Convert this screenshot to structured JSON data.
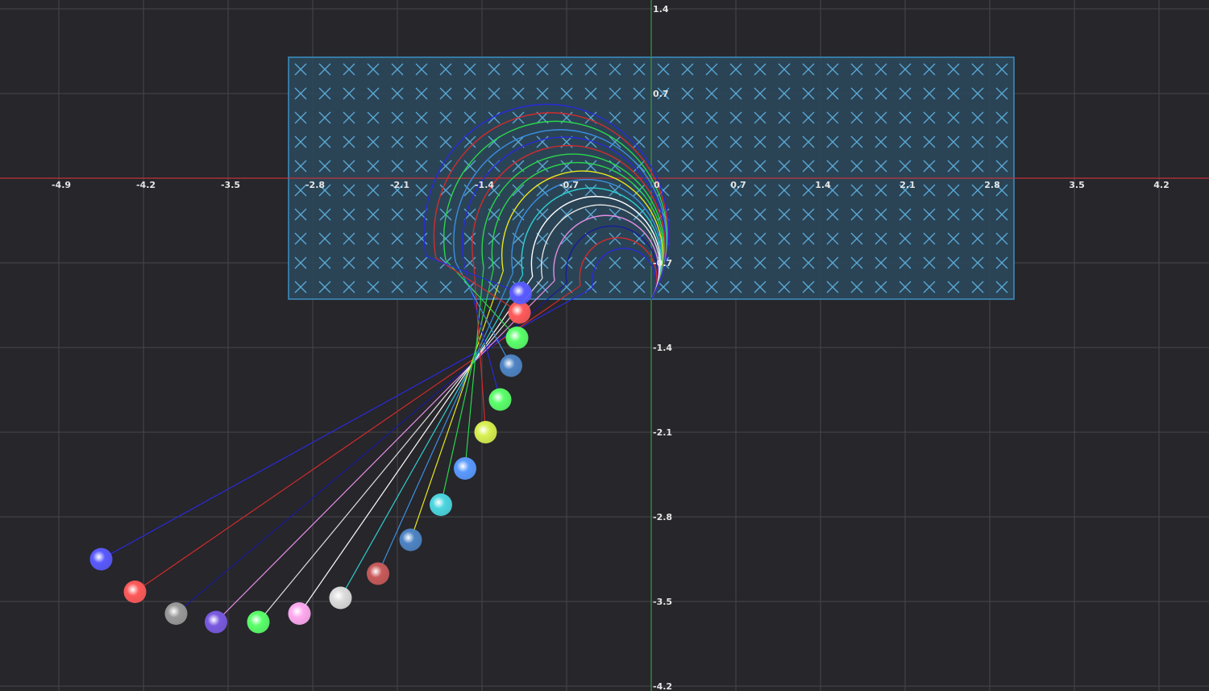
{
  "axes": {
    "x_ticks": [
      "-4.9",
      "-4.2",
      "-3.5",
      "-2.8",
      "-2.1",
      "-1.4",
      "-0.7",
      "0",
      "0.7",
      "1.4",
      "2.1",
      "2.8",
      "3.5",
      "4.2"
    ],
    "y_ticks": [
      "1.4",
      "0.7",
      "-0.7",
      "-1.4",
      "-2.1",
      "-2.8",
      "-3.5",
      "-4.2"
    ],
    "x_axis_color": "#c0343a",
    "y_axis_color": "#3a9a3a",
    "grid_color": "#45454b",
    "background": "#26262b"
  },
  "magnetic_field": {
    "region": {
      "x_min": -3.0,
      "x_max": 3.0,
      "y_min": -1.0,
      "y_max": 1.0
    },
    "direction": "into-page",
    "symbol": "×",
    "fill": "#2c4a5e",
    "border": "#3d8fc4",
    "cross_color": "#5aa9d6"
  },
  "entry_point": {
    "x": 0,
    "y": -1.0
  },
  "particles": [
    {
      "color": "#2a2ad9",
      "ball": "#5a5aff",
      "radius": 0.48,
      "hit": [
        -1.08,
        -0.95
      ],
      "end": [
        -4.55,
        -3.15
      ]
    },
    {
      "color": "#d22b2b",
      "ball": "#ff5a5a",
      "radius": 0.58,
      "hit": [
        -1.08,
        -1.1
      ],
      "end": [
        -4.27,
        -3.42
      ]
    },
    {
      "color": "#1b1b9a",
      "ball": "#9a9a9a",
      "radius": 0.69,
      "hit": [
        -1.15,
        -1.3
      ],
      "end": [
        -3.93,
        -3.6
      ]
    },
    {
      "color": "#e58ee5",
      "ball": "#7a5ae0",
      "radius": 0.79,
      "hit": [
        -1.2,
        -1.55
      ],
      "end": [
        -3.6,
        -3.67
      ]
    },
    {
      "color": "#e0e0e0",
      "ball": "#5aff6a",
      "radius": 0.89,
      "hit": [
        -1.28,
        -1.85
      ],
      "end": [
        -3.25,
        -3.67
      ]
    },
    {
      "color": "#ffffff",
      "ball": "#ffaaf0",
      "radius": 0.97,
      "hit": [
        -1.38,
        -2.14
      ],
      "end": [
        -2.91,
        -3.6
      ]
    },
    {
      "color": "#2fd0d0",
      "ball": "#dcdcdc",
      "radius": 1.05,
      "hit": [
        -1.55,
        -2.43
      ],
      "end": [
        -2.57,
        -3.47
      ]
    },
    {
      "color": "#3b8fe0",
      "ball": "#c85a5a",
      "radius": 1.13,
      "hit": [
        -1.75,
        -2.7
      ],
      "end": [
        -2.26,
        -3.27
      ]
    },
    {
      "color": "#e8e81c",
      "ball": "#4e84c4",
      "radius": 1.21,
      "hit": [
        -1.97,
        -2.98
      ],
      "end": [
        -1.99,
        -2.99
      ]
    },
    {
      "color": "#2ad64a",
      "ball": "#4cd6e0",
      "radius": 1.29,
      "hit": [
        -1.76,
        -2.7
      ],
      "end": [
        -1.74,
        -2.7
      ]
    },
    {
      "color": "#2ad64a",
      "ball": "#5a9aff",
      "radius": 1.37,
      "hit": [
        -1.55,
        -2.4
      ],
      "end": [
        -1.54,
        -2.4
      ]
    },
    {
      "color": "#d22b2b",
      "ball": "#d8f050",
      "radius": 1.45,
      "hit": [
        -1.38,
        -2.1
      ],
      "end": [
        -1.37,
        -2.1
      ]
    },
    {
      "color": "#2a2ad9",
      "ball": "#5aff6a",
      "radius": 1.53,
      "hit": [
        -1.25,
        -1.83
      ],
      "end": [
        -1.25,
        -1.83
      ]
    },
    {
      "color": "#3b8fe0",
      "ball": "#4e84c4",
      "radius": 1.6,
      "hit": [
        -1.16,
        -1.55
      ],
      "end": [
        -1.16,
        -1.55
      ]
    },
    {
      "color": "#2ad64a",
      "ball": "#5aff6a",
      "radius": 1.68,
      "hit": [
        -1.11,
        -1.32
      ],
      "end": [
        -1.11,
        -1.32
      ]
    },
    {
      "color": "#d22b2b",
      "ball": "#ff5a5a",
      "radius": 1.76,
      "hit": [
        -1.09,
        -1.11
      ],
      "end": [
        -1.09,
        -1.11
      ]
    },
    {
      "color": "#2a2ad9",
      "ball": "#5a5aff",
      "radius": 1.84,
      "hit": [
        -1.08,
        -0.95
      ],
      "end": [
        -1.08,
        -0.95
      ]
    }
  ]
}
